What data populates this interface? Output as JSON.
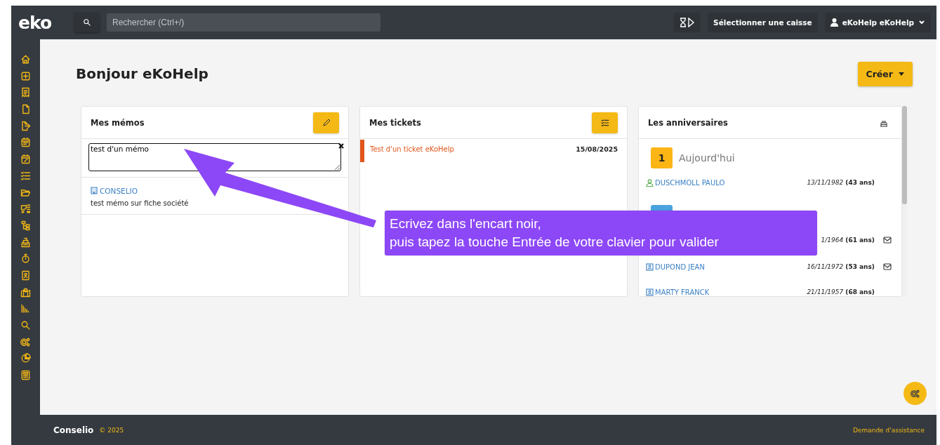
{
  "topbar": {
    "logo": "eko",
    "search": {
      "placeholder": "Rechercher (Ctrl+/)"
    },
    "register_button": "Sélectionner une caisse",
    "user_menu": "eKoHelp eKoHelp"
  },
  "page": {
    "title": "Bonjour eKoHelp",
    "create_button": "Créer"
  },
  "memos": {
    "title": "Mes mémos",
    "input": {
      "value": "test d'un mémo"
    },
    "items": [
      {
        "company": "CONSELIO",
        "text": "test mémo sur fiche société"
      }
    ]
  },
  "tickets": {
    "title": "Mes tickets",
    "items": [
      {
        "title": "Test d'un ticket eKoHelp",
        "date": "15/08/2025",
        "color": "#e0561b"
      }
    ]
  },
  "birthdays": {
    "title": "Les anniversaires",
    "sections": [
      {
        "badge": "1",
        "label": "Aujourd'hui",
        "color": "#fbb515",
        "items": [
          {
            "kind": "person",
            "name": "DUSCHMOLL PAULO",
            "date": "13/11/1982",
            "age": "(43 ans)",
            "mail": false
          }
        ]
      },
      {
        "color": "#4aa3df",
        "items": [
          {
            "kind": "hidden",
            "date": "1/1964",
            "age": "(61 ans)",
            "mail": true
          },
          {
            "kind": "contact",
            "name": "DUPOND JEAN",
            "date": "16/11/1972",
            "age": "(53 ans)",
            "mail": true
          },
          {
            "kind": "contact",
            "name": "MARTY FRANCK",
            "date": "21/11/1957",
            "age": "(68 ans)",
            "mail": false
          }
        ]
      }
    ]
  },
  "annotation": {
    "lines": [
      "Ecrivez dans l'encart noir,",
      "puis tapez la touche Entrée de votre clavier pour valider"
    ]
  },
  "footer": {
    "brand": "Conselio",
    "copyright": "© 2025",
    "help_link": "Demande d'assistance"
  }
}
